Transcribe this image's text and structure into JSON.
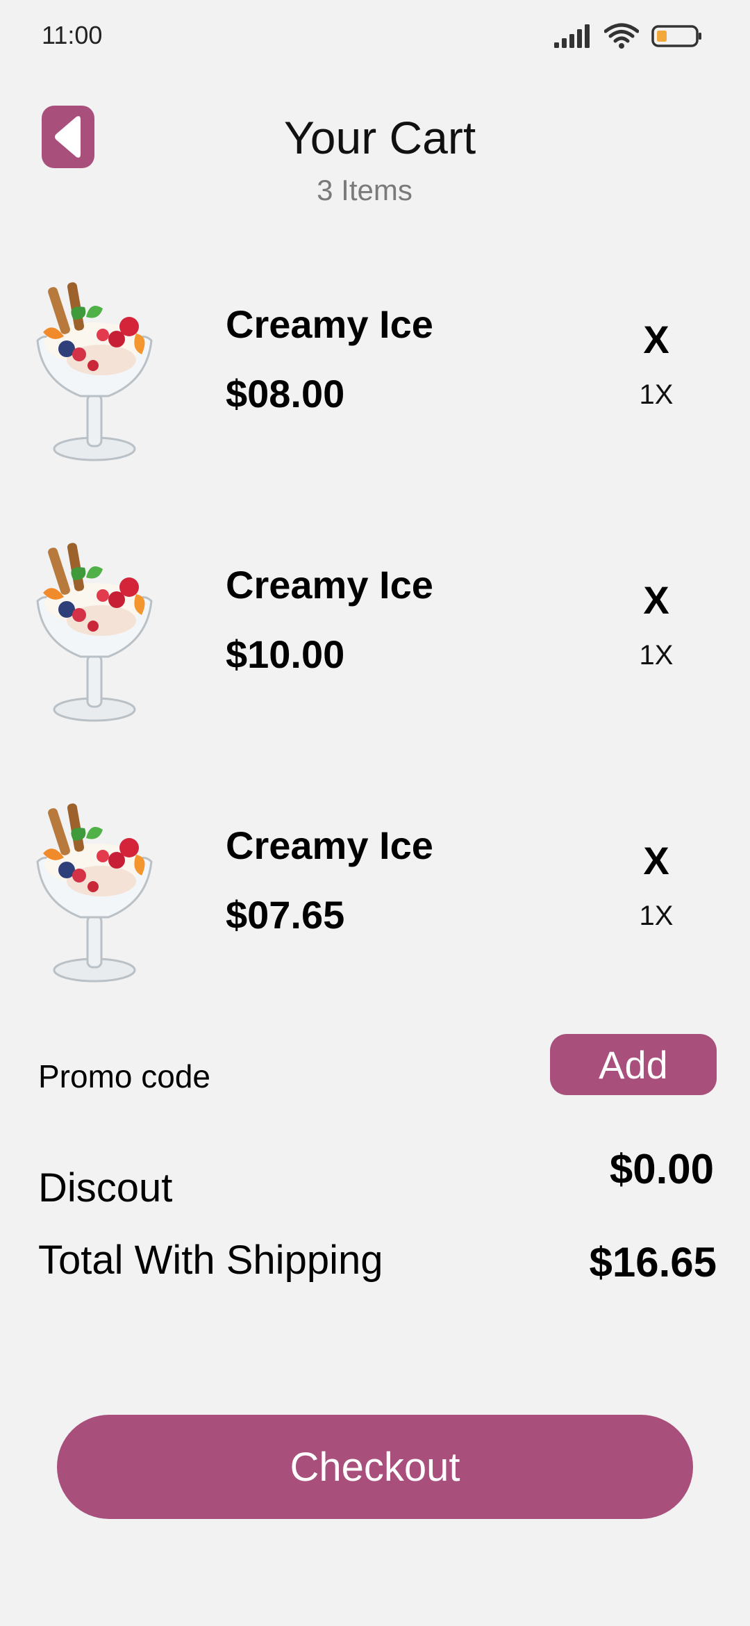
{
  "status_bar": {
    "time": "11:00"
  },
  "header": {
    "back_icon": "back-arrow-icon",
    "title": "Your Cart",
    "subtitle": "3 Items"
  },
  "cart": {
    "items": [
      {
        "name": "Creamy Ice",
        "price": "$08.00",
        "remove_label": "X",
        "quantity": "1X",
        "image": "ice-cream-sundae"
      },
      {
        "name": "Creamy Ice",
        "price": "$10.00",
        "remove_label": "X",
        "quantity": "1X",
        "image": "ice-cream-sundae"
      },
      {
        "name": "Creamy Ice",
        "price": "$07.65",
        "remove_label": "X",
        "quantity": "1X",
        "image": "ice-cream-sundae"
      }
    ]
  },
  "promo": {
    "label": "Promo code",
    "add_label": "Add"
  },
  "summary": {
    "discount_label": "Discout",
    "discount_value": "$0.00",
    "total_label": "Total With Shipping",
    "total_value": "$16.65"
  },
  "checkout": {
    "label": "Checkout"
  },
  "colors": {
    "accent": "#a94f7b",
    "background": "#f2f2f2",
    "subtitle": "#7a7a7a",
    "battery": "#f2a83a"
  }
}
